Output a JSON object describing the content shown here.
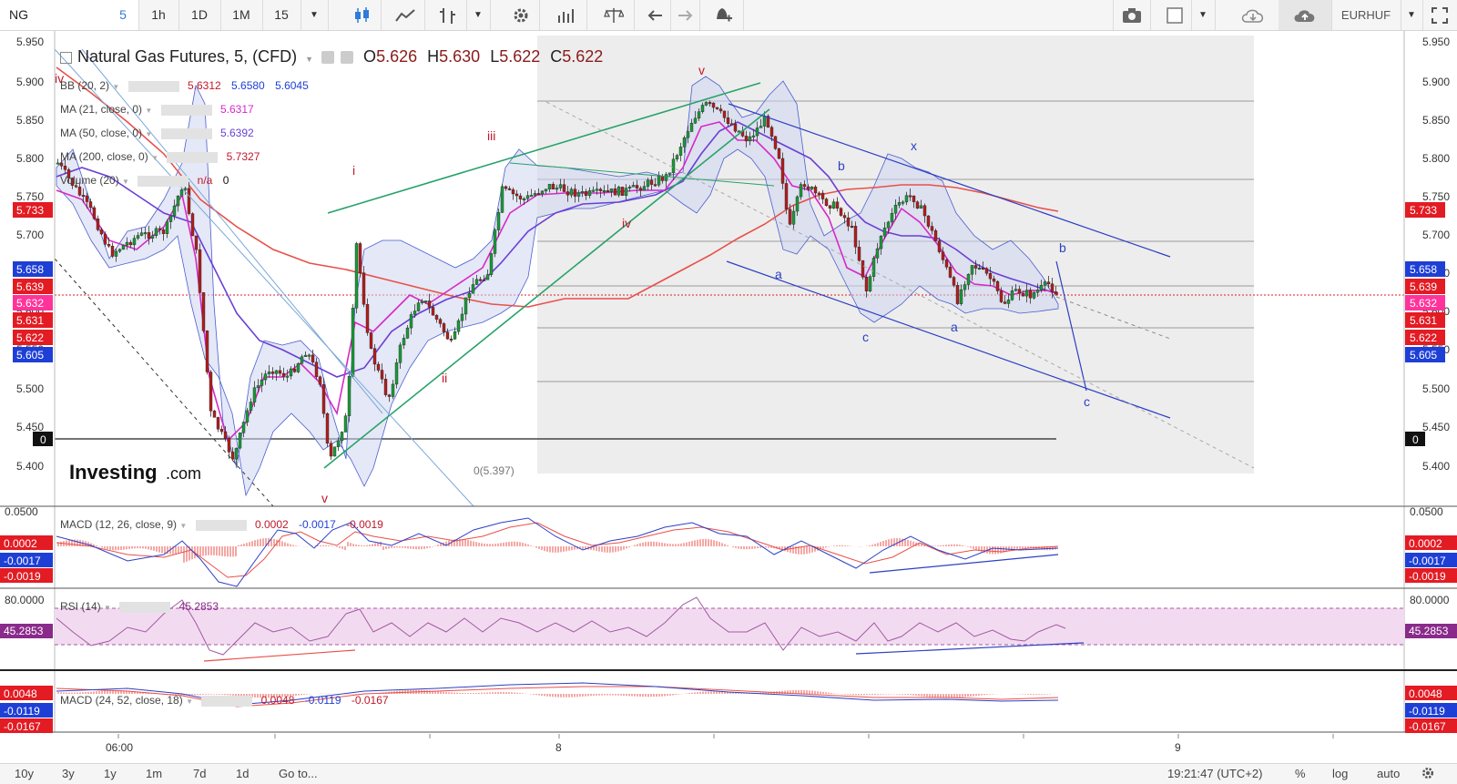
{
  "toolbar": {
    "symbol": "NG",
    "intervals": [
      "5",
      "1h",
      "1D",
      "1M"
    ],
    "active_interval": "5",
    "minutes_select": "15",
    "currency": "EURHUF"
  },
  "header": {
    "title": "Natural Gas Futures, 5, (CFD)",
    "o_label": "O",
    "o_value": "5.626",
    "h_label": "H",
    "h_value": "5.630",
    "l_label": "L",
    "l_value": "5.622",
    "c_label": "C",
    "c_value": "5.622"
  },
  "indicators": {
    "bb": {
      "label": "BB (20, 2)",
      "v1": "5.6312",
      "v2": "5.6580",
      "v3": "5.6045"
    },
    "ma21": {
      "label": "MA (21, close, 0)",
      "v": "5.6317"
    },
    "ma50": {
      "label": "MA (50, close, 0)",
      "v": "5.6392"
    },
    "ma200": {
      "label": "MA (200, close, 0)",
      "v": "5.7327"
    },
    "volume": {
      "label": "Volume (20)",
      "v1": "n/a",
      "v2": "0"
    },
    "macd1": {
      "label": "MACD (12, 26, close, 9)",
      "v1": "0.0002",
      "v2": "-0.0017",
      "v3": "-0.0019"
    },
    "rsi": {
      "label": "RSI (14)",
      "v": "45.2853"
    },
    "macd2": {
      "label": "MACD (24, 52, close, 18)",
      "v1": "0.0048",
      "v2": "-0.0119",
      "v3": "-0.0167"
    }
  },
  "price_axis": {
    "ticks": [
      "5.950",
      "5.900",
      "5.850",
      "5.800",
      "5.750",
      "5.700",
      "5.650",
      "5.600",
      "5.550",
      "5.500",
      "5.450",
      "5.400"
    ],
    "badges": [
      {
        "text": "5.733",
        "color": "#e31b23"
      },
      {
        "text": "5.658",
        "color": "#1e3fd6"
      },
      {
        "text": "5.639",
        "color": "#e31b23"
      },
      {
        "text": "5.632",
        "color": "#ff3399"
      },
      {
        "text": "5.631",
        "color": "#e31b23"
      },
      {
        "text": "5.622",
        "color": "#e31b23"
      },
      {
        "text": "5.605",
        "color": "#1e3fd6"
      }
    ],
    "zero_badge": "0"
  },
  "macd_axis": {
    "ticks": [
      "0.0500"
    ],
    "badges": [
      {
        "text": "0.0002",
        "color": "#e31b23"
      },
      {
        "text": "-0.0017",
        "color": "#1e3fd6"
      },
      {
        "text": "-0.0019",
        "color": "#e31b23"
      }
    ]
  },
  "rsi_axis": {
    "ticks": [
      "80.0000"
    ],
    "badge": "45.2853"
  },
  "macd2_axis": {
    "badges": [
      {
        "text": "0.0048",
        "color": "#e31b23"
      },
      {
        "text": "-0.0119",
        "color": "#1e3fd6"
      },
      {
        "text": "-0.0167",
        "color": "#e31b23"
      }
    ]
  },
  "time_axis": {
    "labels": [
      "06:00",
      "8",
      "9"
    ]
  },
  "waves": {
    "red": [
      "iv",
      "i",
      "iii",
      "ii",
      "iv",
      "v",
      "v"
    ],
    "blue": [
      "a",
      "b",
      "c",
      "x",
      "a",
      "b",
      "c"
    ]
  },
  "watermark": {
    "brand": "Investing",
    "suffix": ".com"
  },
  "fib_label": "0(5.397)",
  "bottombar": {
    "ranges": [
      "10y",
      "3y",
      "1y",
      "1m",
      "7d",
      "1d"
    ],
    "goto": "Go to...",
    "clock": "19:21:47 (UTC+2)",
    "percent": "%",
    "log": "log",
    "auto": "auto"
  },
  "colors": {
    "red": "#e31b23",
    "blue": "#1e3fd6",
    "magenta": "#d629c8",
    "ma200": "#e8504a",
    "green": "#26a269",
    "rsi": "#a458a4"
  }
}
